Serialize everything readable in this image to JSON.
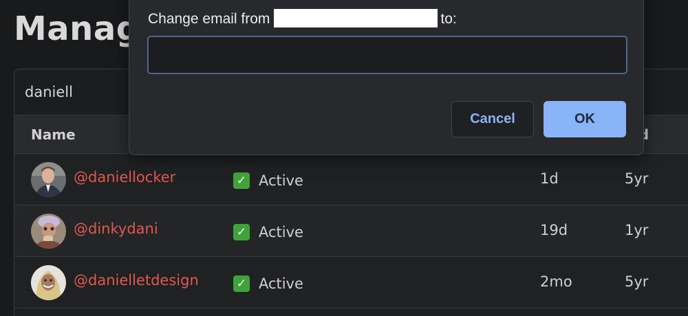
{
  "page": {
    "title": "Manage"
  },
  "search": {
    "value": "daniell"
  },
  "table": {
    "headers": {
      "name": "Name",
      "joined": "ned"
    },
    "rows": [
      {
        "username": "@daniellocker",
        "status": "Active",
        "last_seen": "1d",
        "joined": "5yr"
      },
      {
        "username": "@dinkydani",
        "status": "Active",
        "last_seen": "19d",
        "joined": "1yr"
      },
      {
        "username": "@danielletdesign",
        "status": "Active",
        "last_seen": "2mo",
        "joined": "5yr"
      }
    ]
  },
  "dialog": {
    "message_prefix": "Change email from",
    "message_suffix": "to:",
    "input_value": "",
    "cancel_label": "Cancel",
    "ok_label": "OK"
  },
  "colors": {
    "username": "#e0594d",
    "accent_button": "#8ab4f8",
    "status_check": "#3fa33a"
  },
  "icons": {
    "status": "check-mark-icon"
  }
}
